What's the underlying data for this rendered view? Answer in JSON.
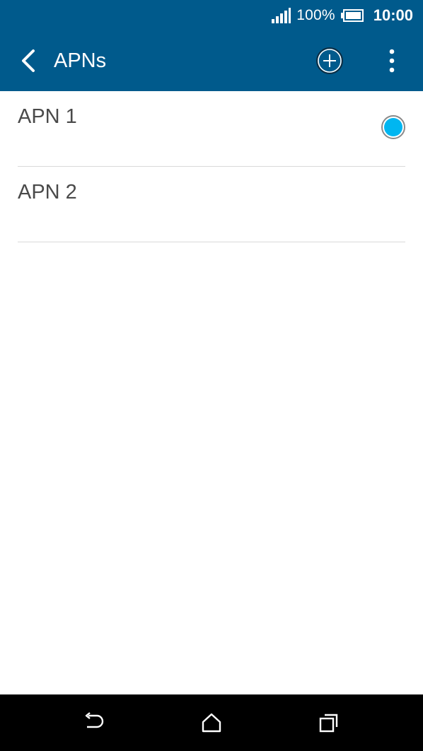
{
  "status_bar": {
    "battery_percent": "100%",
    "time": "10:00"
  },
  "app_bar": {
    "title": "APNs"
  },
  "apn_list": {
    "items": [
      {
        "name": "APN 1",
        "selected": true
      },
      {
        "name": "APN 2",
        "selected": false
      }
    ]
  },
  "colors": {
    "header": "#005a8c",
    "radio_selected": "#00b6f1",
    "nav_bar": "#000000"
  },
  "icons": {
    "status": [
      "signal-icon",
      "battery-icon"
    ],
    "app_bar": [
      "back-arrow-icon",
      "add-circle-icon",
      "overflow-menu-icon"
    ],
    "nav_bar": [
      "back-icon",
      "home-icon",
      "recent-apps-icon"
    ]
  }
}
